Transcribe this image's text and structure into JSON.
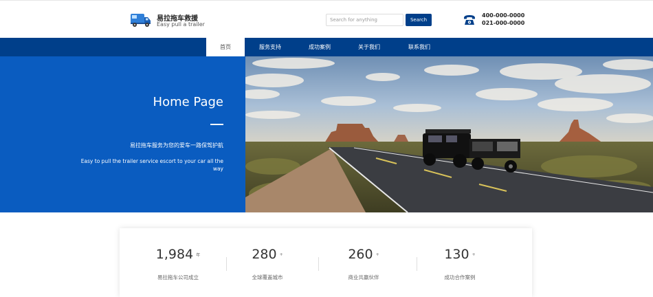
{
  "header": {
    "brand_name": "易拉拖车救援",
    "brand_tagline": "Easy pull a trailer",
    "logo_icon": "trailer-truck-icon",
    "search_placeholder": "Search for anything",
    "search_button": "Search",
    "phone_icon": "telephone-icon",
    "phone_1": "400-000-0000",
    "phone_2": "021-000-0000"
  },
  "nav": {
    "items": [
      {
        "label": "首页",
        "active": true
      },
      {
        "label": "服务支持",
        "active": false
      },
      {
        "label": "成功案例",
        "active": false
      },
      {
        "label": "关于我们",
        "active": false
      },
      {
        "label": "联系我们",
        "active": false
      }
    ]
  },
  "hero": {
    "title": "Home Page",
    "subtitle_cn": "易拉拖车服务为您的爱车一路保驾护航",
    "subtitle_en": "Easy to pull the trailer service escort to your car all the way"
  },
  "stats": [
    {
      "value": "1,984",
      "unit": "年",
      "label": "易拉拖车公司成立"
    },
    {
      "value": "280",
      "unit": "+",
      "label": "全球覆盖城市"
    },
    {
      "value": "260",
      "unit": "+",
      "label": "商业共赢伙伴"
    },
    {
      "value": "130",
      "unit": "+",
      "label": "成功合作案例"
    }
  ],
  "colors": {
    "nav_blue": "#003f8a",
    "hero_blue": "#0a5cc0",
    "button_blue": "#003f8a"
  }
}
